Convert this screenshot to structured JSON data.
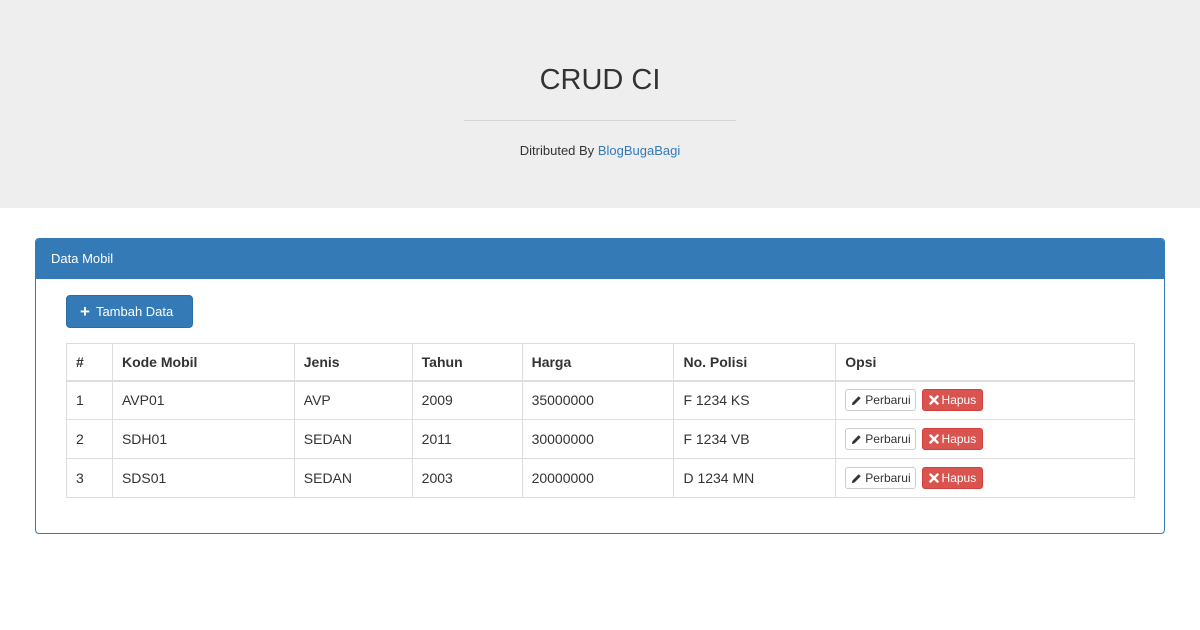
{
  "header": {
    "title": "CRUD CI",
    "subtitle_prefix": "Ditributed By ",
    "subtitle_link": "BlogBugaBagi"
  },
  "panel": {
    "heading": "Data Mobil",
    "add_button_label": "Tambah Data"
  },
  "table": {
    "columns": [
      "#",
      "Kode Mobil",
      "Jenis",
      "Tahun",
      "Harga",
      "No. Polisi",
      "Opsi"
    ],
    "rows": [
      {
        "no": "1",
        "kode": "AVP01",
        "jenis": "AVP",
        "tahun": "2009",
        "harga": "35000000",
        "polisi": "F 1234 KS"
      },
      {
        "no": "2",
        "kode": "SDH01",
        "jenis": "SEDAN",
        "tahun": "2011",
        "harga": "30000000",
        "polisi": "F 1234 VB"
      },
      {
        "no": "3",
        "kode": "SDS01",
        "jenis": "SEDAN",
        "tahun": "2003",
        "harga": "20000000",
        "polisi": "D 1234 MN"
      }
    ],
    "edit_label": "Perbarui",
    "delete_label": "Hapus"
  },
  "icons": {
    "add": "plus-icon",
    "edit": "pencil-icon",
    "delete": "remove-icon"
  },
  "colors": {
    "primary": "#337ab7",
    "danger": "#d9534f",
    "jumbotron": "#eeeeee"
  }
}
